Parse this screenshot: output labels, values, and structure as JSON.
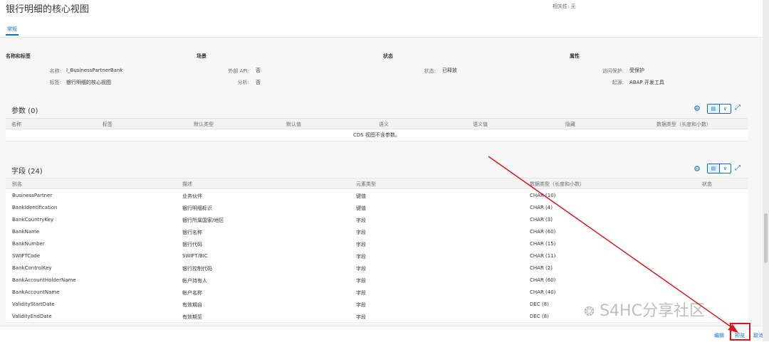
{
  "header": {
    "title": "银行明细的核心视图",
    "relevance": "相关性: 无",
    "tab": "常规"
  },
  "general": {
    "section_names": [
      "名称和标签",
      "场景",
      "状态",
      "属性"
    ],
    "name_label": "名称:",
    "name_value": "I_BusinessPartnerBank",
    "tag_label": "标签:",
    "tag_value": "银行明细的核心视图",
    "api_label": "外部 API:",
    "api_value": "否",
    "analysis_label": "分析:",
    "analysis_value": "否",
    "status_label": "状态:",
    "status_value": "已释放",
    "access_label": "访问保护:",
    "access_value": "受保护",
    "origin_label": "起源:",
    "origin_value": "ABAP 开发工具"
  },
  "params": {
    "title": "参数 (0)",
    "headers": [
      "名称",
      "标签",
      "默认类型",
      "默认值",
      "语义",
      "语义值",
      "隐藏",
      "数据类型（长度和小数）"
    ],
    "empty_text": "CDS 视图不含参数。"
  },
  "fields": {
    "title": "字段 (24)",
    "headers": [
      "别名",
      "描述",
      "元素类型",
      "数据类型（长度和小数）",
      "状态"
    ],
    "rows": [
      [
        "BusinessPartner",
        "业务伙伴",
        "键值",
        "CHAR (10)"
      ],
      [
        "BankIdentification",
        "银行明细标识",
        "键值",
        "CHAR (4)"
      ],
      [
        "BankCountryKey",
        "银行所属国家/地区",
        "字段",
        "CHAR (3)"
      ],
      [
        "BankName",
        "银行名称",
        "字段",
        "CHAR (60)"
      ],
      [
        "BankNumber",
        "银行代码",
        "字段",
        "CHAR (15)"
      ],
      [
        "SWIFTCode",
        "SWIFT/BIC",
        "字段",
        "CHAR (11)"
      ],
      [
        "BankControlKey",
        "银行控制代码",
        "字段",
        "CHAR (2)"
      ],
      [
        "BankAccountHolderName",
        "帐户持有人",
        "字段",
        "CHAR (60)"
      ],
      [
        "BankAccountName",
        "帐户名称",
        "字段",
        "CHAR (40)"
      ],
      [
        "ValidityStartDate",
        "有效期自",
        "字段",
        "DEC (8)"
      ],
      [
        "ValidityEndDate",
        "有效期至",
        "字段",
        "DEC (8)"
      ]
    ]
  },
  "footer": {
    "edit": "编辑",
    "preview": "预览",
    "cancel": "取消"
  },
  "watermark": "S4HC分享社区",
  "icons": {
    "settings": "⚙",
    "table_view": "▤",
    "dropdown": "∨",
    "fullscreen": "⤢"
  },
  "colors": {
    "accent": "#0a6ed1",
    "annotation": "#e0131a"
  }
}
